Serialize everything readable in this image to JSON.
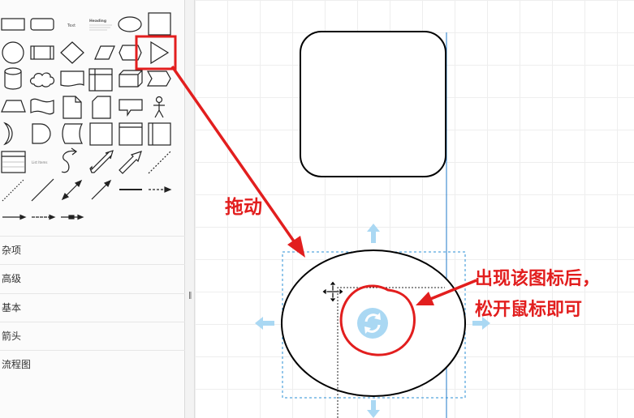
{
  "sidebar": {
    "sections": [
      {
        "label": "杂项"
      },
      {
        "label": "高级"
      },
      {
        "label": "基本"
      },
      {
        "label": "箭头"
      },
      {
        "label": "流程图"
      }
    ],
    "shape_text": {
      "text": "Text",
      "heading": "Heading",
      "list_items": "List Items"
    }
  },
  "annotations": {
    "drag": "拖动",
    "release_line1": "出现该图标后，",
    "release_line2": "松开鼠标即可"
  },
  "colors": {
    "annotation": "#e21e1e",
    "guide": "#1f78c8",
    "drop_hint": "#aad8f3"
  }
}
